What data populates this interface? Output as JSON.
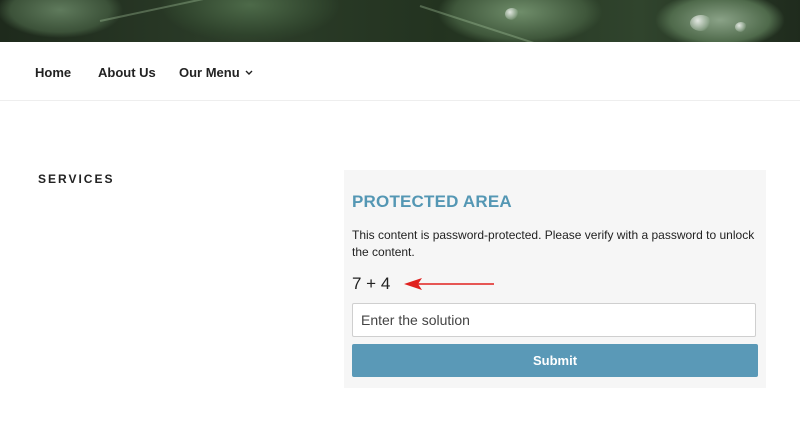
{
  "nav": {
    "items": [
      {
        "label": "Home"
      },
      {
        "label": "About Us"
      },
      {
        "label": "Our Menu"
      }
    ]
  },
  "sidebar": {
    "heading": "SERVICES"
  },
  "protected": {
    "title": "PROTECTED AREA",
    "description": "This content is password-protected. Please verify with a password to unlock the content.",
    "captcha": "7 + 4",
    "input_placeholder": "Enter the solution",
    "submit_label": "Submit"
  },
  "colors": {
    "accent": "#5497b4",
    "button": "#5a99b7",
    "arrow": "#e0201e"
  }
}
